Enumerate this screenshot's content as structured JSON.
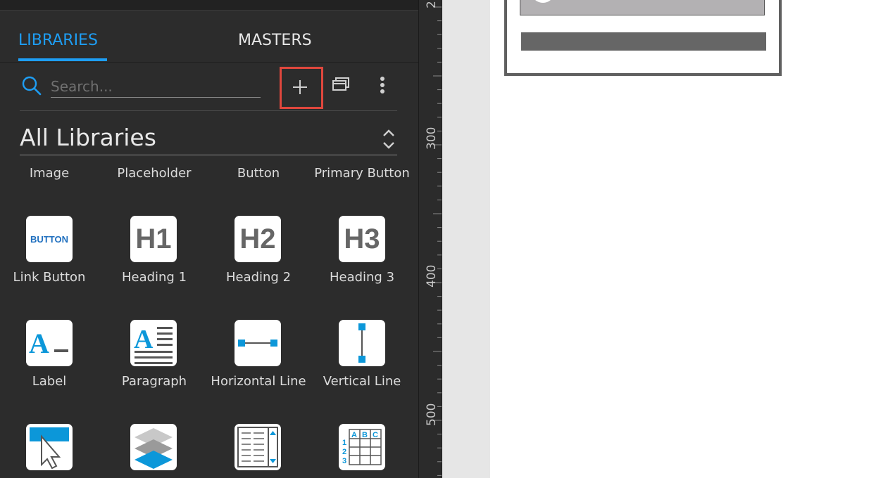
{
  "panel": {
    "tabs": {
      "libraries": "LIBRARIES",
      "masters": "MASTERS"
    },
    "search": {
      "placeholder": "Search..."
    },
    "library_select": {
      "value": "All Libraries"
    },
    "top_row_labels": [
      "Image",
      "Placeholder",
      "Button",
      "Primary Button"
    ],
    "widgets": [
      {
        "label": "Link Button",
        "icon": "link-button-icon",
        "text": "BUTTON"
      },
      {
        "label": "Heading 1",
        "icon": "heading-1-icon",
        "text": "H1"
      },
      {
        "label": "Heading 2",
        "icon": "heading-2-icon",
        "text": "H2"
      },
      {
        "label": "Heading 3",
        "icon": "heading-3-icon",
        "text": "H3"
      },
      {
        "label": "Label",
        "icon": "label-icon"
      },
      {
        "label": "Paragraph",
        "icon": "paragraph-icon"
      },
      {
        "label": "Horizontal Line",
        "icon": "horizontal-line-icon"
      },
      {
        "label": "Vertical Line",
        "icon": "vertical-line-icon"
      },
      {
        "icon": "hotspot-icon"
      },
      {
        "icon": "dynamic-panel-icon"
      },
      {
        "icon": "repeater-icon"
      },
      {
        "icon": "table-icon",
        "header": [
          "A",
          "B",
          "C"
        ],
        "rows": [
          "1",
          "2",
          "3"
        ]
      }
    ]
  },
  "ruler": {
    "labels": [
      "2",
      "300",
      "400",
      "500"
    ]
  },
  "colors": {
    "accent": "#1e9ef4",
    "highlight": "#e0473d",
    "panel_bg": "#2c2c2c",
    "icon_blue": "#0c97d9"
  }
}
